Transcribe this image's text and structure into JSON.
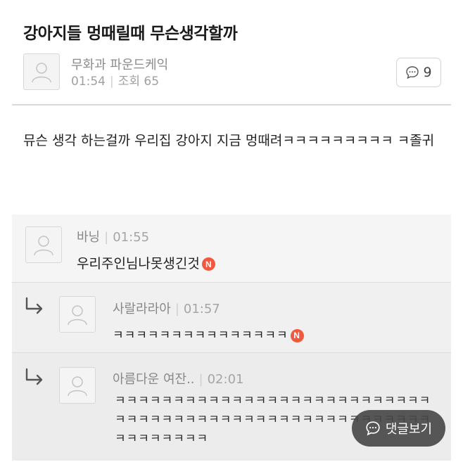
{
  "post": {
    "title": "강아지들 멍때릴때 무슨생각할까",
    "author": "무화과 파운드케익",
    "time": "01:54",
    "views_label": "조회 65",
    "comment_count": "9",
    "body": "뮤슨 생각 하는걸까 우리집 강아지 지금 멍때려ㅋㅋㅋㅋㅋㅋㅋㅋㅋ ㅋ졸귀"
  },
  "comments": [
    {
      "author": "바닝",
      "time": "01:55",
      "text": "우리주인님나못생긴것",
      "badge": "N"
    },
    {
      "author": "사랄라라아",
      "time": "01:57",
      "text": "ㅋㅋㅋㅋㅋㅋㅋㅋㅋㅋㅋㅋㅋㅋㅋ",
      "badge": "N"
    },
    {
      "author": "아름다운 여잔..",
      "time": "02:01",
      "text": "ㅋㅋㅋㅋㅋㅋㅋㅋㅋㅋㅋㅋㅋㅋㅋㅋㅋㅋㅋㅋㅋㅋㅋㅋㅋㅋㅋㅋㅋㅋㅋㅋㅋㅋㅋㅋㅋㅋㅋㅋㅋㅋㅋㅋㅋㅋㅋㅋㅋㅋㅋㅋㅋㅋㅋㅋㅋㅋㅋㅋㅋㅋ"
    }
  ],
  "view_comments_label": "댓글보기",
  "colors": {
    "badge": "#f0593e",
    "floating_button": "#464646"
  },
  "icons": [
    "avatar-placeholder-icon",
    "comment-bubble-icon",
    "reply-arrow-icon",
    "new-badge-icon"
  ]
}
